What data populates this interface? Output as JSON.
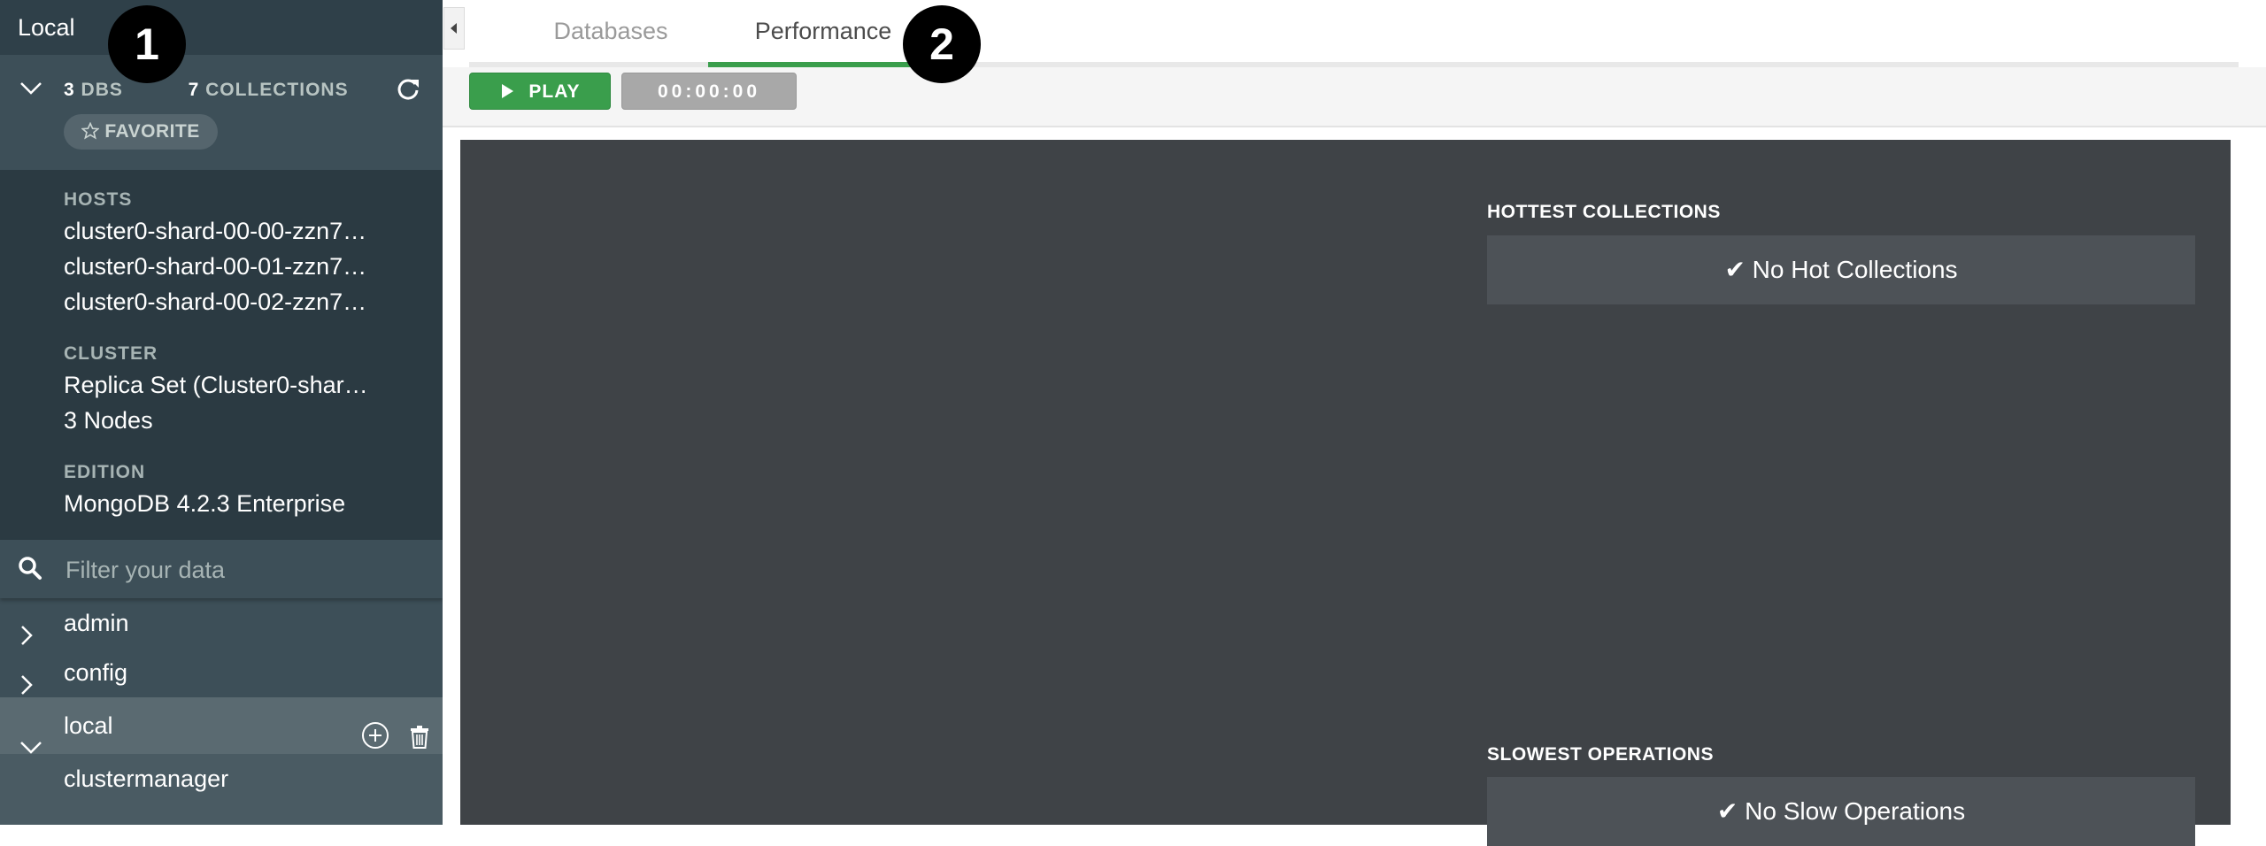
{
  "sidebar": {
    "title": "Local",
    "stats": {
      "dbs_count": "3",
      "dbs_label": "DBS",
      "collections_count": "7",
      "collections_label": "COLLECTIONS"
    },
    "favorite_label": "FAVORITE",
    "hosts_label": "HOSTS",
    "hosts": [
      "cluster0-shard-00-00-zzn7…",
      "cluster0-shard-00-01-zzn7…",
      "cluster0-shard-00-02-zzn7…"
    ],
    "cluster_label": "CLUSTER",
    "cluster_value": "Replica Set (Cluster0-shar…",
    "cluster_nodes": "3 Nodes",
    "edition_label": "EDITION",
    "edition_value": "MongoDB 4.2.3 Enterprise",
    "filter_placeholder": "Filter your data",
    "databases": [
      {
        "name": "admin"
      },
      {
        "name": "config"
      },
      {
        "name": "local"
      }
    ],
    "collections": [
      "clustermanager",
      "…"
    ]
  },
  "tabs": [
    {
      "label": "Databases"
    },
    {
      "label": "Performance"
    }
  ],
  "toolbar": {
    "play_label": "PLAY",
    "timer": "00:00:00"
  },
  "panel": {
    "hottest_title": "HOTTEST COLLECTIONS",
    "hottest_empty": "✔ No Hot Collections",
    "slowest_title": "SLOWEST OPERATIONS",
    "slowest_empty": "✔ No Slow Operations"
  },
  "markers": [
    "1",
    "2"
  ],
  "colors": {
    "accent_green": "#3a9e4c",
    "sidebar_bg": "#3d4f58",
    "panel_bg": "#3f4347"
  }
}
